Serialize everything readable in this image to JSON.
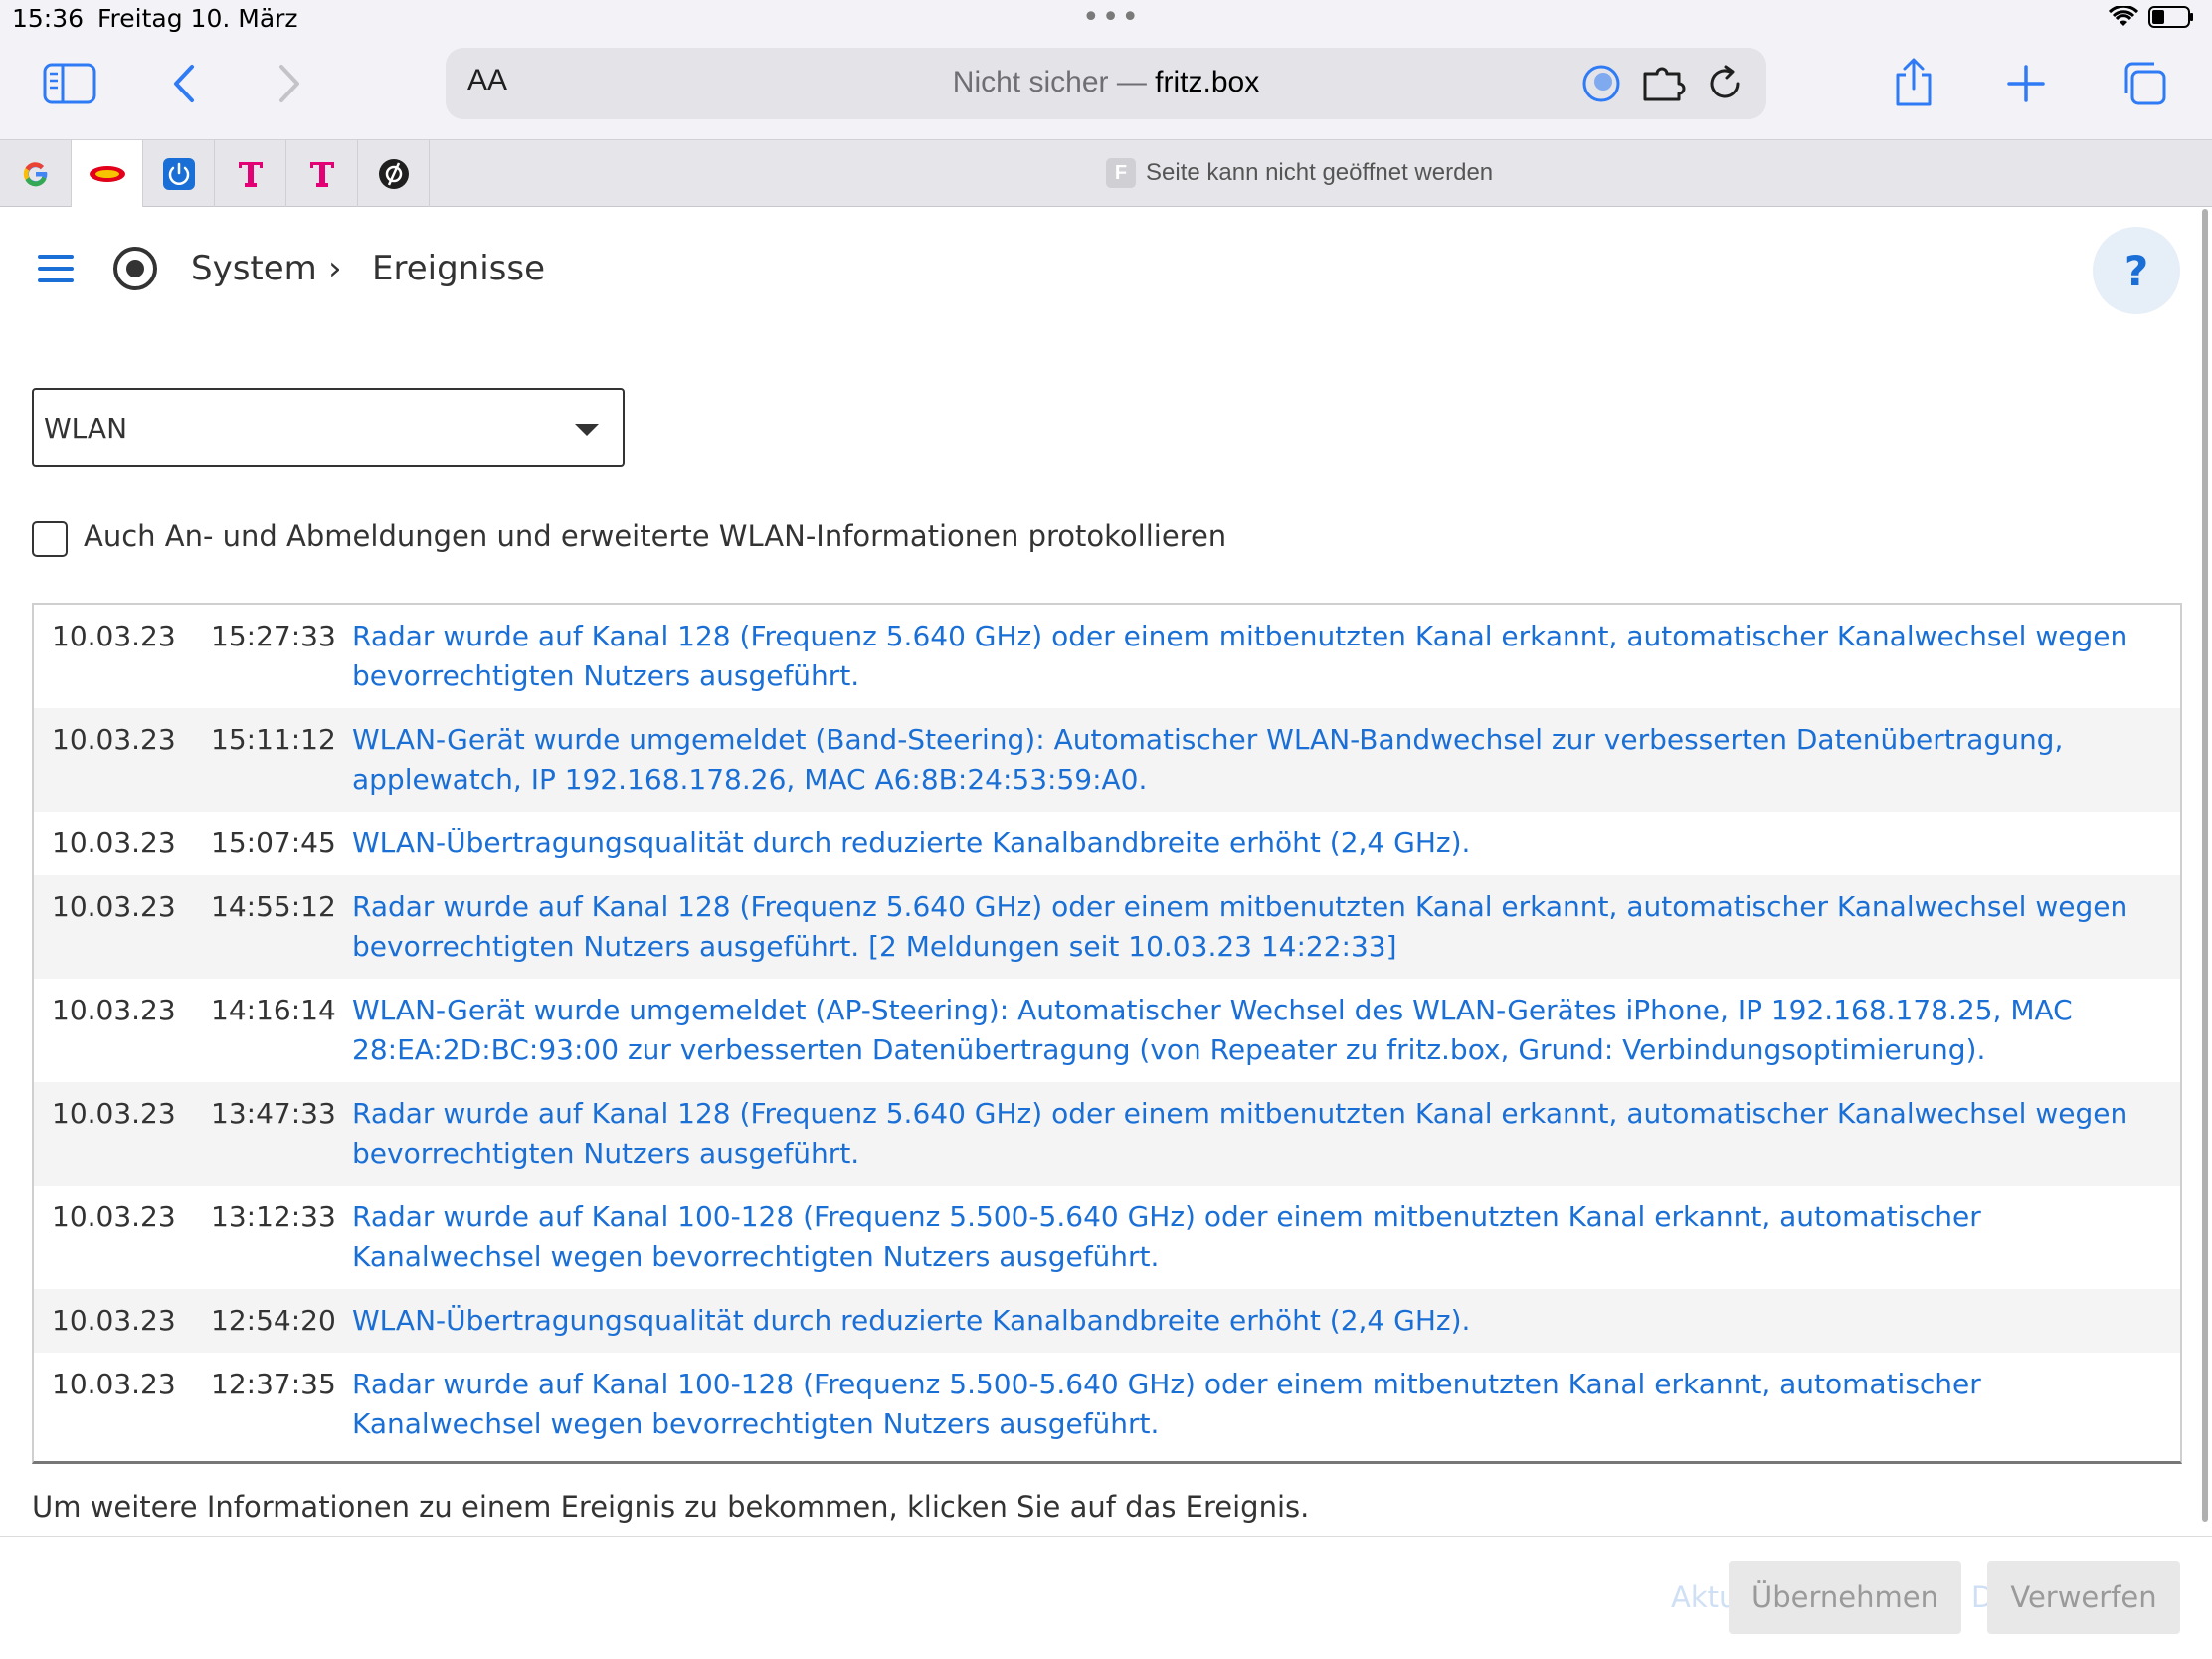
{
  "status_bar": {
    "time": "15:36",
    "date": "Freitag 10. März",
    "dots": "•••"
  },
  "toolbar": {
    "text_size_label": "AA",
    "url_prefix": "Nicht sicher — ",
    "url_host": "fritz.box"
  },
  "favorites": {
    "tab_favicon_letter": "F",
    "tab_title": "Seite kann nicht geöffnet werden"
  },
  "breadcrumb": {
    "level1": "System",
    "separator": "›",
    "level2": "Ereignisse"
  },
  "help_label": "?",
  "filter": {
    "selected": "WLAN"
  },
  "checkbox": {
    "label": "Auch An- und Abmeldungen und erweiterte WLAN-Informationen protokollieren",
    "checked": false
  },
  "events": [
    {
      "date": "10.03.23",
      "time": "15:27:33",
      "message": "Radar wurde auf Kanal 128 (Frequenz 5.640 GHz) oder einem mitbenutzten Kanal erkannt, automatischer Kanalwechsel wegen bevorrechtigten Nutzers ausgeführt."
    },
    {
      "date": "10.03.23",
      "time": "15:11:12",
      "message": "WLAN-Gerät wurde umgemeldet (Band-Steering): Automatischer WLAN-Bandwechsel zur verbesserten Datenübertragung, applewatch, IP 192.168.178.26, MAC A6:8B:24:53:59:A0."
    },
    {
      "date": "10.03.23",
      "time": "15:07:45",
      "message": "WLAN-Übertragungsqualität durch reduzierte Kanalbandbreite erhöht (2,4 GHz)."
    },
    {
      "date": "10.03.23",
      "time": "14:55:12",
      "message": "Radar wurde auf Kanal 128 (Frequenz 5.640 GHz) oder einem mitbenutzten Kanal erkannt, automatischer Kanalwechsel wegen bevorrechtigten Nutzers ausgeführt. [2 Meldungen seit 10.03.23 14:22:33]"
    },
    {
      "date": "10.03.23",
      "time": "14:16:14",
      "message": "WLAN-Gerät wurde umgemeldet (AP-Steering): Automatischer Wechsel des WLAN-Gerätes iPhone, IP 192.168.178.25, MAC 28:EA:2D:BC:93:00 zur verbesserten Datenübertragung (von Repeater zu fritz.box, Grund: Verbindungsoptimierung)."
    },
    {
      "date": "10.03.23",
      "time": "13:47:33",
      "message": "Radar wurde auf Kanal 128 (Frequenz 5.640 GHz) oder einem mitbenutzten Kanal erkannt, automatischer Kanalwechsel wegen bevorrechtigten Nutzers ausgeführt."
    },
    {
      "date": "10.03.23",
      "time": "13:12:33",
      "message": "Radar wurde auf Kanal 100-128 (Frequenz 5.500-5.640 GHz) oder einem mitbenutzten Kanal erkannt, automatischer Kanalwechsel wegen bevorrechtigten Nutzers ausgeführt."
    },
    {
      "date": "10.03.23",
      "time": "12:54:20",
      "message": "WLAN-Übertragungsqualität durch reduzierte Kanalbandbreite erhöht (2,4 GHz)."
    },
    {
      "date": "10.03.23",
      "time": "12:37:35",
      "message": "Radar wurde auf Kanal 100-128 (Frequenz 5.500-5.640 GHz) oder einem mitbenutzten Kanal erkannt, automatischer Kanalwechsel wegen bevorrechtigten Nutzers ausgeführt."
    }
  ],
  "hint": "Um weitere Informationen zu einem Ereignis zu bekommen, klicken Sie auf das Ereignis.",
  "footer": {
    "ghost_left": "Aktu",
    "ghost_mid": "D",
    "apply": "Übernehmen",
    "discard": "Verwerfen"
  },
  "colors": {
    "link": "#1a6fd6",
    "safari_blue": "#2f7bf5",
    "telekom": "#e20074"
  }
}
